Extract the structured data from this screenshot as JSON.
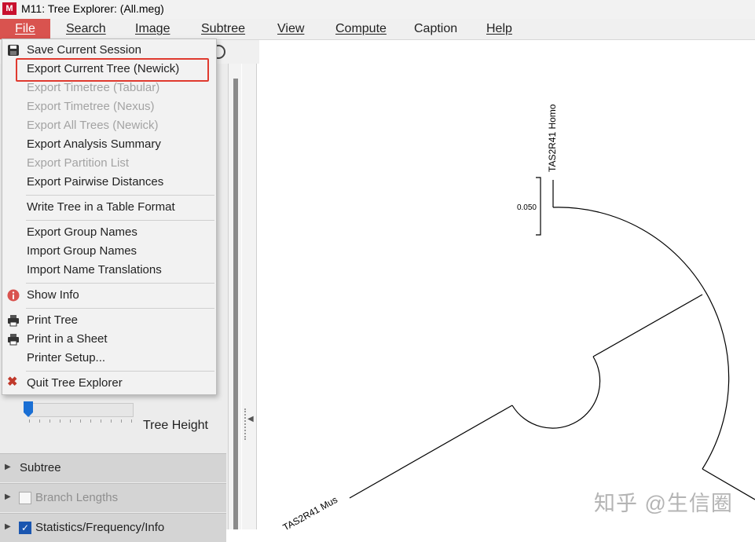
{
  "window": {
    "logo": "M",
    "title": "M11: Tree Explorer: (All.meg)"
  },
  "menubar": [
    "File",
    "Search",
    "Image",
    "Subtree",
    "View",
    "Compute",
    "Caption",
    "Help"
  ],
  "file_menu": {
    "items": [
      {
        "label": "Save Current Session",
        "icon": "save-icon",
        "enabled": true
      },
      {
        "label": "Export Current Tree (Newick)",
        "enabled": true,
        "highlighted": true
      },
      {
        "label": "Export Timetree (Tabular)",
        "enabled": false
      },
      {
        "label": "Export Timetree (Nexus)",
        "enabled": false
      },
      {
        "label": "Export All Trees (Newick)",
        "enabled": false
      },
      {
        "label": "Export Analysis Summary",
        "enabled": true
      },
      {
        "label": "Export Partition List",
        "enabled": false
      },
      {
        "label": "Export Pairwise Distances",
        "enabled": true
      },
      {
        "label": "Write Tree in a Table Format",
        "enabled": true
      },
      {
        "label": "Export Group Names",
        "enabled": true
      },
      {
        "label": "Import Group Names",
        "enabled": true
      },
      {
        "label": "Import Name Translations",
        "enabled": true
      },
      {
        "label": "Show Info",
        "icon": "info-icon",
        "enabled": true
      },
      {
        "label": "Print Tree",
        "icon": "printer-icon",
        "enabled": true
      },
      {
        "label": "Print in a Sheet",
        "icon": "printer-icon",
        "enabled": true
      },
      {
        "label": "Printer Setup...",
        "enabled": true
      },
      {
        "label": "Quit Tree Explorer",
        "icon": "close-icon",
        "enabled": true
      }
    ]
  },
  "left_panel": {
    "tree_height_label": "Tree Height",
    "sections": [
      {
        "label": "Subtree",
        "checkbox": null
      },
      {
        "label": "Branch Lengths",
        "checkbox": false,
        "disabled": true
      },
      {
        "label": "Statistics/Frequency/Info",
        "checkbox": true
      }
    ]
  },
  "tree": {
    "scale_label": "0.050",
    "taxa": [
      "TAS2R41 Homo",
      "TAS2R41 Mus"
    ]
  },
  "watermark": "知乎 @生信圈",
  "colors": {
    "accent": "#d9534f",
    "highlight_box": "#e03a2f",
    "checkbox": "#1a56b0"
  }
}
